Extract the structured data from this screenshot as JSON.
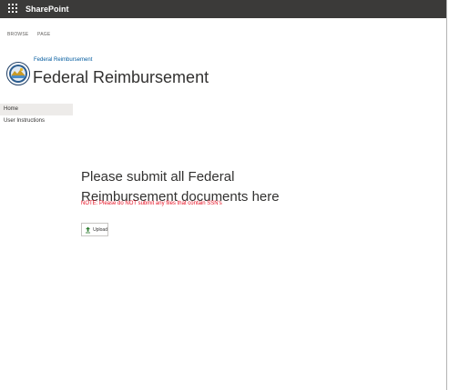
{
  "suite_bar": {
    "app_name": "SharePoint"
  },
  "breadcrumbs": [
    "BROWSE",
    "PAGE"
  ],
  "site": {
    "breadcrumb_label": "Federal Reimbursement",
    "title": "Federal Reimbursement"
  },
  "nav": {
    "items": [
      {
        "label": "Home",
        "active": true
      },
      {
        "label": "User Instructions",
        "active": false
      }
    ]
  },
  "main": {
    "heading": "Please submit all Federal Reimbursement documents here",
    "note": "NOTE: Please do NOT submit any files that contain SSN's",
    "upload_label": "Upload"
  },
  "colors": {
    "suite_bar": "#3b3a39",
    "accent": "#005a9e",
    "note_red": "#e81123",
    "upload_icon": "#2f7d32"
  },
  "icons": {
    "app_launcher": "waffle-icon",
    "upload": "upload-arrow-icon",
    "site_logo": "state-seal-logo"
  }
}
